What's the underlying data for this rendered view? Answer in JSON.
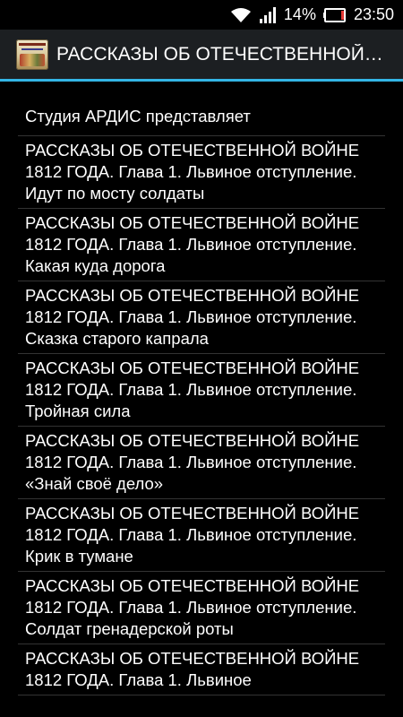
{
  "status_bar": {
    "battery_percent": "14%",
    "time": "23:50",
    "battery_level": 0.14,
    "battery_color": "#e53935"
  },
  "action_bar": {
    "title": "РАССКАЗЫ ОБ ОТЕЧЕСТВЕННОЙ…",
    "icon": "app-book-cover-icon",
    "accent_color": "#33b5e5"
  },
  "list": {
    "items": [
      "Студия АРДИС представляет",
      "РАССКАЗЫ ОБ ОТЕЧЕСТВЕННОЙ ВОЙНЕ 1812 ГОДА. Глава 1. Львиное отступление. Идут по мосту солдаты",
      "РАССКАЗЫ ОБ ОТЕЧЕСТВЕННОЙ ВОЙНЕ 1812 ГОДА. Глава 1. Львиное отступление. Какая куда дорога",
      "РАССКАЗЫ ОБ ОТЕЧЕСТВЕННОЙ ВОЙНЕ 1812 ГОДА. Глава 1. Львиное отступление. Сказка старого капрала",
      "РАССКАЗЫ ОБ ОТЕЧЕСТВЕННОЙ ВОЙНЕ 1812 ГОДА. Глава 1. Львиное отступление. Тройная сила",
      "РАССКАЗЫ ОБ ОТЕЧЕСТВЕННОЙ ВОЙНЕ 1812 ГОДА. Глава 1. Львиное отступление. «Знай своё дело»",
      "РАССКАЗЫ ОБ ОТЕЧЕСТВЕННОЙ ВОЙНЕ 1812 ГОДА. Глава 1. Львиное отступление. Крик в тумане",
      "РАССКАЗЫ ОБ ОТЕЧЕСТВЕННОЙ ВОЙНЕ 1812 ГОДА. Глава 1. Львиное отступление. Солдат гренадерской роты",
      "РАССКАЗЫ ОБ ОТЕЧЕСТВЕННОЙ ВОЙНЕ 1812 ГОДА. Глава 1. Львиное"
    ]
  }
}
